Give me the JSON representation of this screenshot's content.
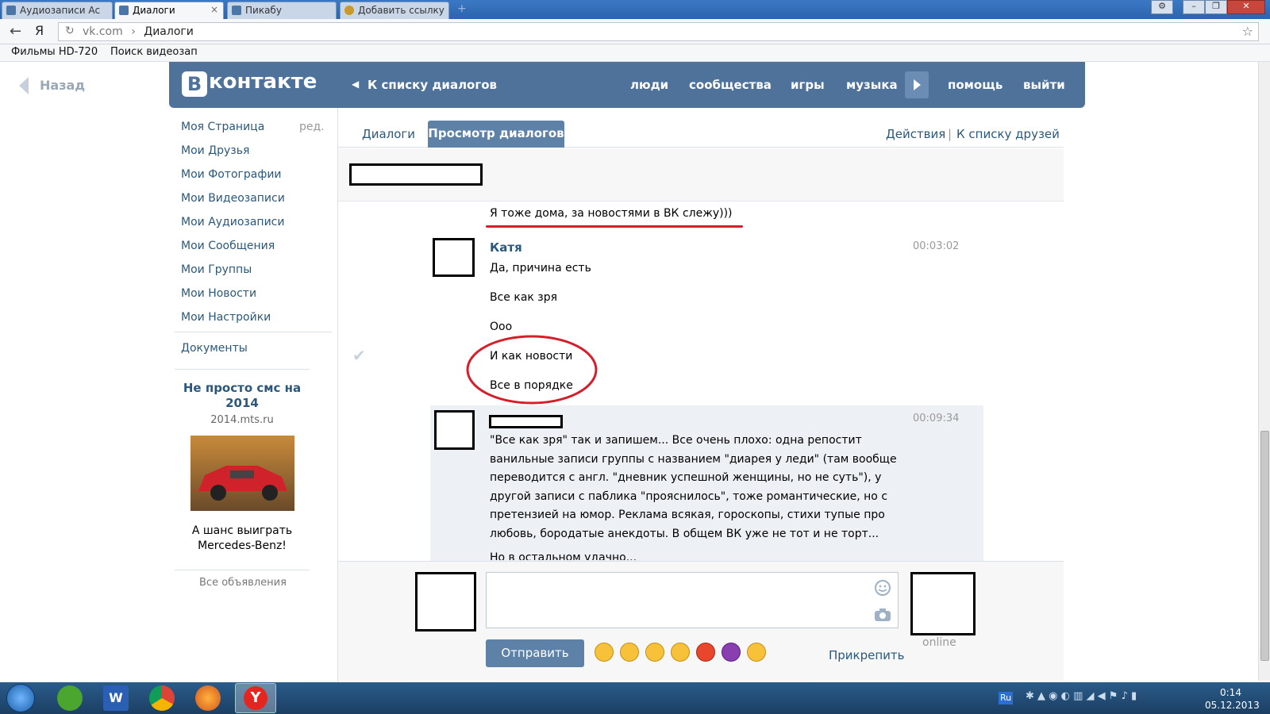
{
  "browser": {
    "tabs": [
      {
        "label": "Аудиозаписи Ас"
      },
      {
        "label": "Диалоги"
      },
      {
        "label": "Пикабу"
      },
      {
        "label": "Добавить ссылку"
      }
    ],
    "close_glyph": "×",
    "new_tab_glyph": "+",
    "back_glyph": "←",
    "yandex_glyph": "Я",
    "url_domain": "vk.com",
    "url_sep": "›",
    "url_page": "Диалоги",
    "star_glyph": "☆",
    "bookmarks": [
      "Фильмы HD-720",
      "Поиск видеозап"
    ]
  },
  "back_link": "Назад",
  "vk": {
    "logo_b": "В",
    "logo_text": "контакте",
    "back_to_list": "К списку диалогов",
    "nav": [
      "люди",
      "сообщества",
      "игры",
      "музыка",
      "помощь",
      "выйти"
    ],
    "menu": [
      "Моя Страница",
      "Мои Друзья",
      "Мои Фотографии",
      "Мои Видеозаписи",
      "Мои Аудиозаписи",
      "Мои Сообщения",
      "Мои Группы",
      "Мои Новости",
      "Мои Настройки"
    ],
    "edit": "ред.",
    "documents": "Документы",
    "ad": {
      "title": "Не просто смс на 2014",
      "domain": "2014.mts.ru",
      "text": "А шанс выиграть Mercedes-Benz!",
      "all": "Все объявления"
    },
    "tabs": {
      "dialogs": "Диалоги",
      "view": "Просмотр диалогов",
      "actions": "Действия",
      "sep": "|",
      "friends": "К списку друзей"
    },
    "messages": {
      "prev_text": "Я тоже дома, за новостями в ВК слежу)))",
      "katya": {
        "name": "Катя",
        "time": "00:03:02",
        "lines": [
          "Да, причина есть",
          "Все как зря",
          "Ооо",
          "И как новости",
          "Все в порядке"
        ]
      },
      "reply": {
        "time": "00:09:34",
        "text": "\"Все как зря\" так и запишем... Все очень плохо: одна репостит ванильные записи группы с названием \"диарея у леди\" (там вообще переводится с англ. \"дневник успешной женщины, но не суть\"), у другой записи с паблика \"прояснилось\", тоже романтические, но с претензией на юмор. Реклама всякая, гороскопы, стихи тупые про любовь, бородатые анекдоты. В общем ВК уже не тот и не торт...",
        "cut": "Но в остальном удачно..."
      }
    },
    "compose": {
      "send": "Отправить",
      "attach": "Прикрепить",
      "online": "online"
    },
    "check_glyph": "✔"
  },
  "taskbar": {
    "time": "0:14",
    "date": "05.12.2013",
    "lang": "Ru"
  }
}
